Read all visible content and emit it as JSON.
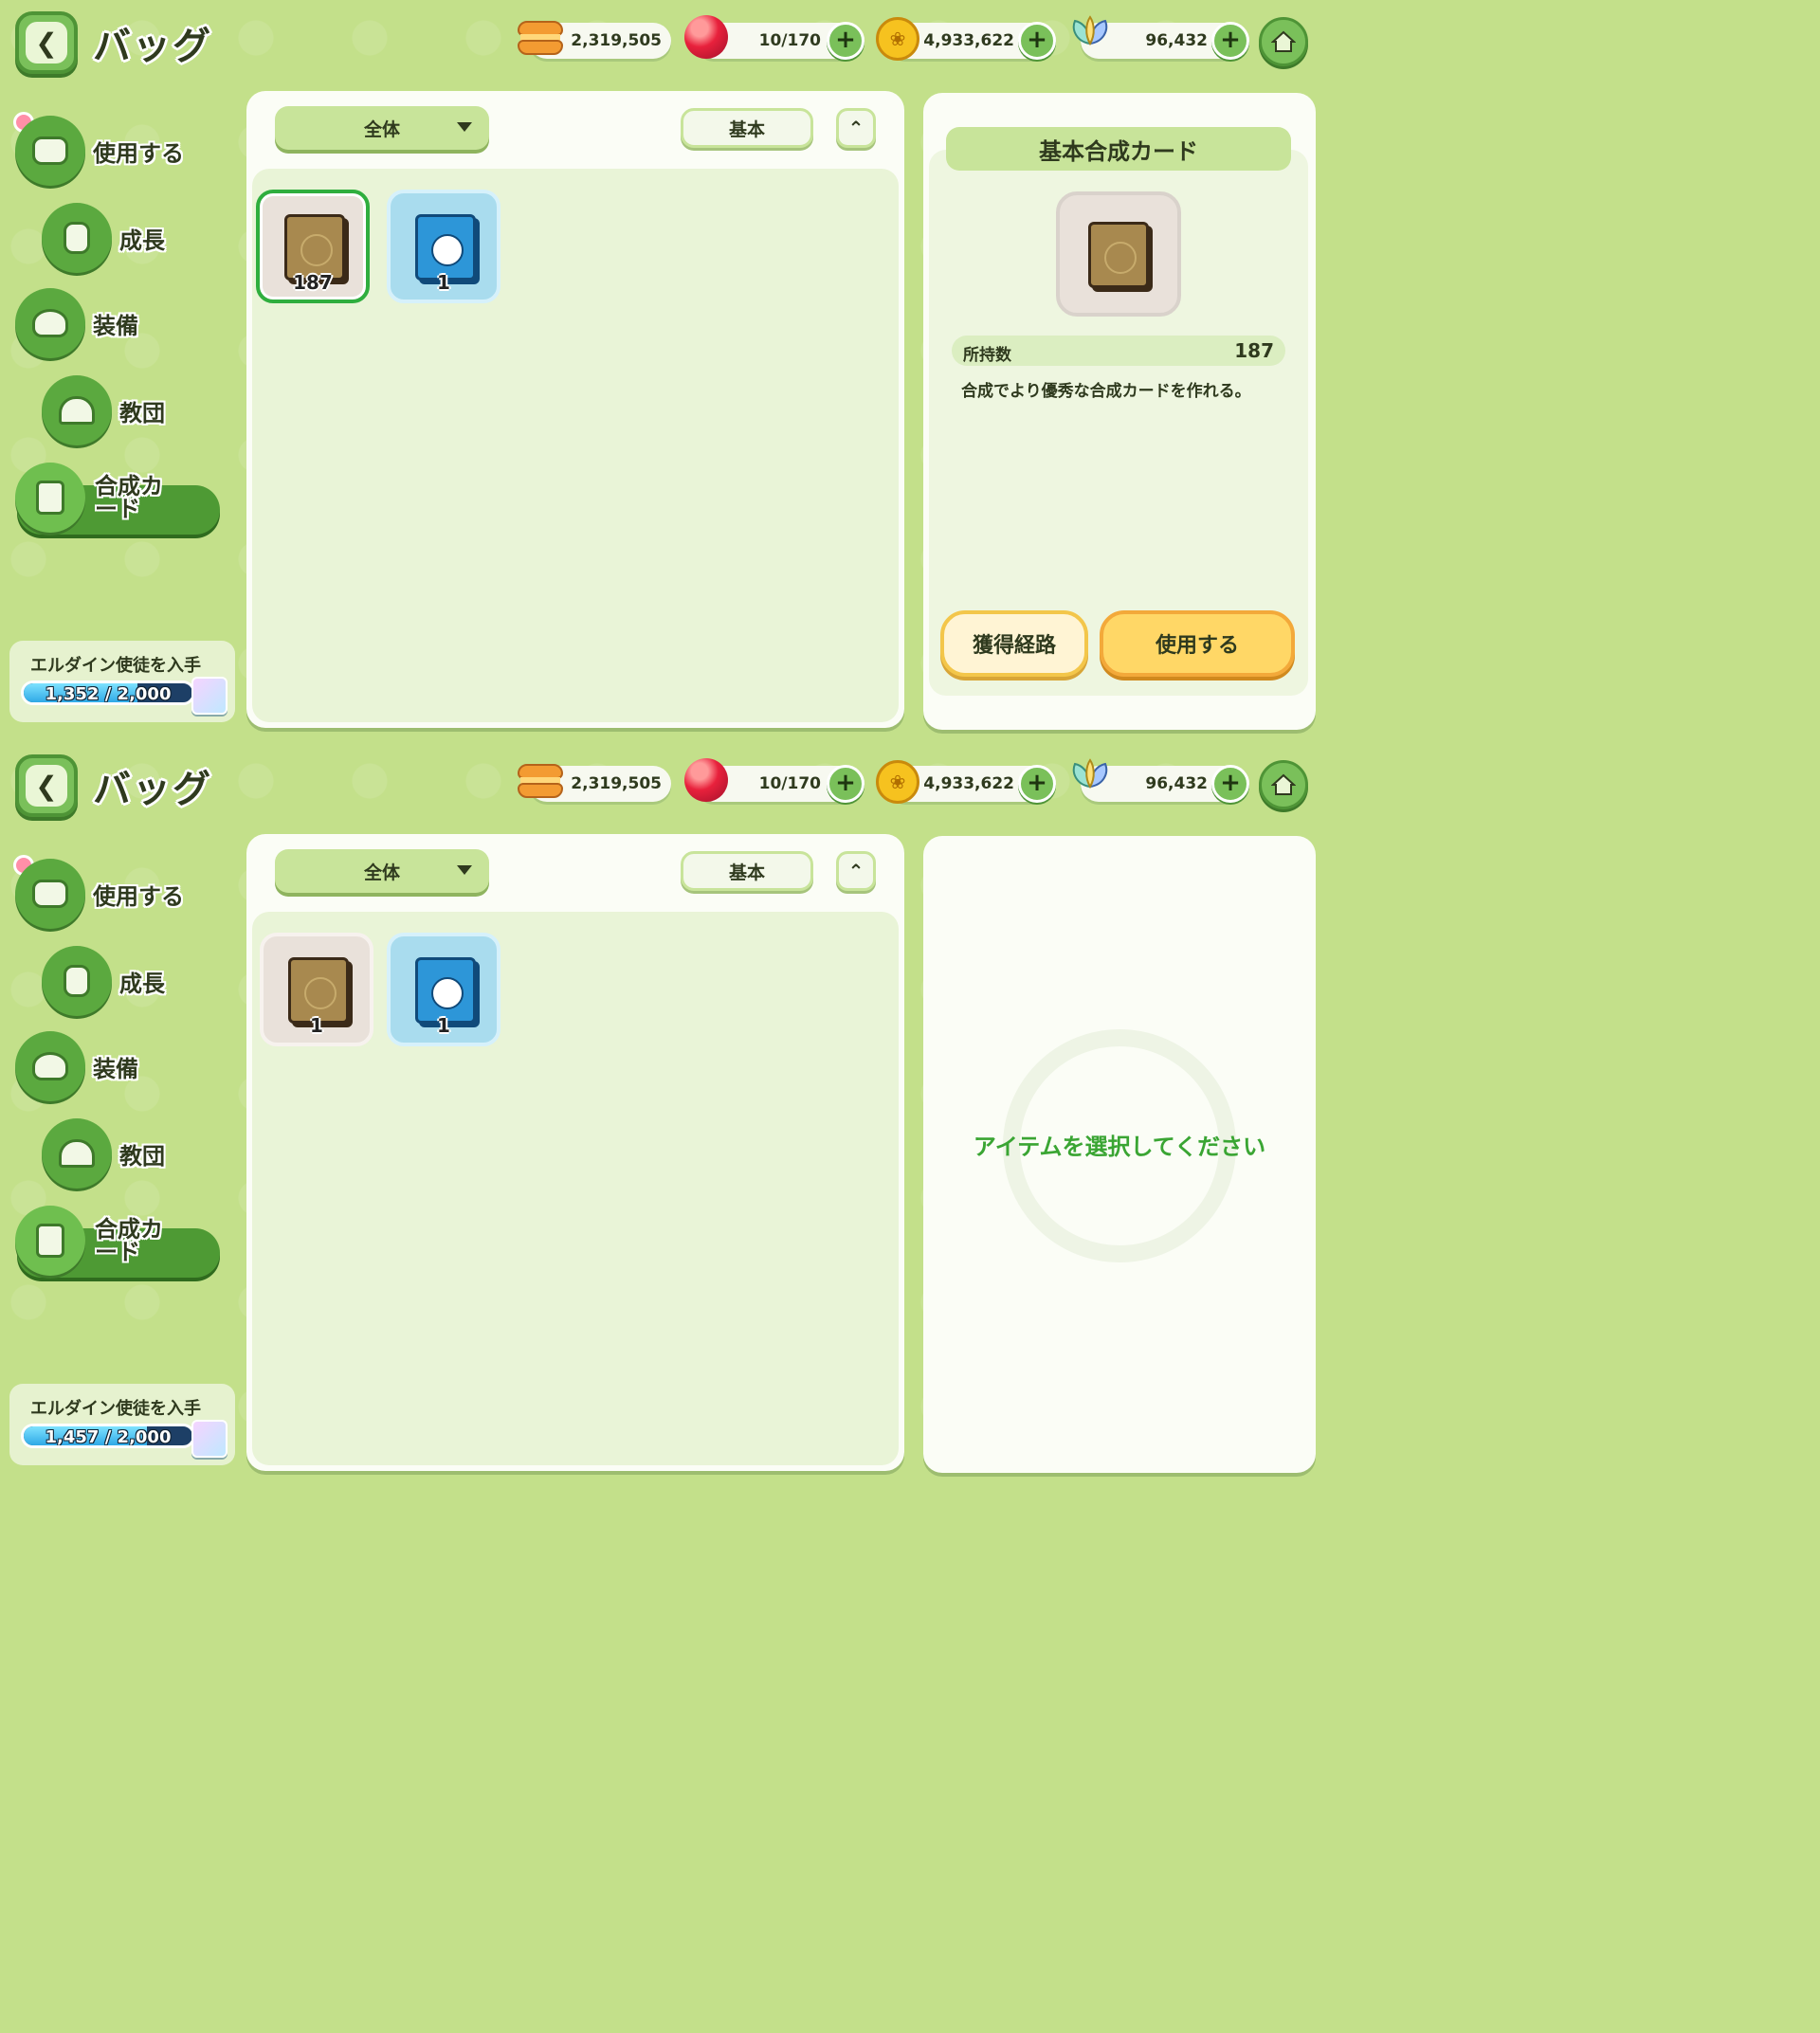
{
  "screens": [
    {
      "header": {
        "title": "バッグ"
      },
      "resources": {
        "cookies": "2,319,505",
        "stamina": "10/170",
        "coins": "4,933,622",
        "crystals": "96,432"
      },
      "filter": {
        "category": "全体",
        "sort": "基本"
      },
      "sidebar": {
        "use": "使用する",
        "growth": "成長",
        "equip": "装備",
        "order": "教団",
        "card": "合成カード"
      },
      "items": [
        {
          "count": "187"
        },
        {
          "count": "1"
        }
      ],
      "detail": {
        "title": "基本合成カード",
        "owned_label": "所持数",
        "owned_value": "187",
        "description": "合成でより優秀な合成カードを作れる。",
        "source_button": "獲得経路",
        "use_button": "使用する"
      },
      "progress": {
        "title": "エルダイン使徒を入手",
        "text": "1,352 / 2,000",
        "fraction": 0.676
      }
    },
    {
      "header": {
        "title": "バッグ"
      },
      "resources": {
        "cookies": "2,319,505",
        "stamina": "10/170",
        "coins": "4,933,622",
        "crystals": "96,432"
      },
      "filter": {
        "category": "全体",
        "sort": "基本"
      },
      "sidebar": {
        "use": "使用する",
        "growth": "成長",
        "equip": "装備",
        "order": "教団",
        "card": "合成カード"
      },
      "items": [
        {
          "count": "1"
        },
        {
          "count": "1"
        }
      ],
      "empty_message": "アイテムを選択してください",
      "progress": {
        "title": "エルダイン使徒を入手",
        "text": "1,457 / 2,000",
        "fraction": 0.7285
      }
    }
  ],
  "icons": [
    "back-arrow-icon",
    "cookie-icon",
    "candy-icon",
    "coin-icon",
    "crystal-leaf-icon",
    "home-icon",
    "chest-icon",
    "potion-icon",
    "armor-icon",
    "tower-icon",
    "card-icon",
    "plus-icon",
    "chevron-down-icon",
    "double-chevron-up-icon"
  ],
  "colors": {
    "background": "#c3e08a",
    "accent_green": "#5ba93f",
    "selected_border": "#2fae3e",
    "button_yellow": "#ffd766",
    "empty_text": "#3aa533"
  }
}
